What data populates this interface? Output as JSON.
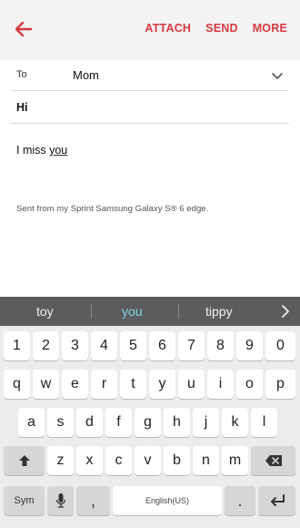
{
  "header": {
    "back_icon": "arrow-left-icon",
    "attach_label": "ATTACH",
    "send_label": "SEND",
    "more_label": "MORE",
    "accent_color": "#d8383f"
  },
  "compose": {
    "to_label": "To",
    "to_value": "Mom",
    "subject": "Hi",
    "message_prefix": "I miss ",
    "message_word": "you",
    "signature": "Sent from my Sprint Samsung Galaxy S® 6 edge."
  },
  "keyboard": {
    "suggestions": [
      "toy",
      "you",
      "tippy"
    ],
    "active_suggestion": "you",
    "number_row": [
      "1",
      "2",
      "3",
      "4",
      "5",
      "6",
      "7",
      "8",
      "9",
      "0"
    ],
    "row1": [
      "q",
      "w",
      "e",
      "r",
      "t",
      "y",
      "u",
      "i",
      "o",
      "p"
    ],
    "row2": [
      "a",
      "s",
      "d",
      "f",
      "g",
      "h",
      "j",
      "k",
      "l"
    ],
    "row3": [
      "z",
      "x",
      "c",
      "v",
      "b",
      "n",
      "m"
    ],
    "sym_label": "Sym",
    "comma": ",",
    "space_label": "English(US)",
    "period": "."
  }
}
